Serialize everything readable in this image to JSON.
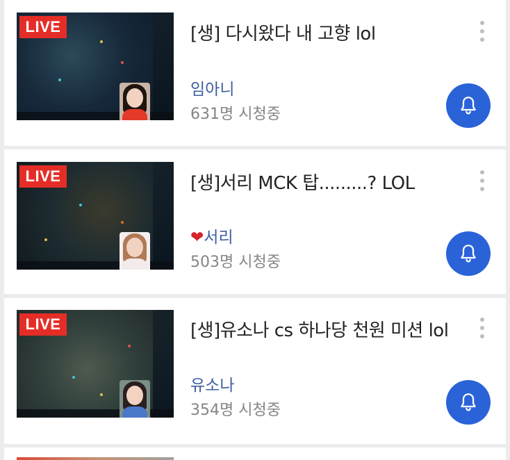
{
  "live_label": "LIVE",
  "streams": [
    {
      "title": "[생] 다시왔다 내 고향 lol",
      "channel_prefix": "",
      "channel": "임아니",
      "viewers": "631명 시청중",
      "thumb_colors": {
        "map": "#16283a",
        "accent": "#264050",
        "hair": "#1e1410",
        "shirt": "#e33a2a"
      }
    },
    {
      "title": "[생]서리 MCK 탑.........? LOL",
      "channel_prefix": "❤",
      "channel": "서리",
      "viewers": "503명 시청중",
      "thumb_colors": {
        "map": "#1d2b30",
        "accent": "#3a3a2c",
        "hair": "#b07a55",
        "shirt": "#f3eaea"
      }
    },
    {
      "title": "[생]유소나 cs 하나당 천원 미션 lol",
      "channel_prefix": "",
      "channel": "유소나",
      "viewers": "354명 시청중",
      "thumb_colors": {
        "map": "#2e3c3a",
        "accent": "#4c5a4e",
        "hair": "#2a1f1f",
        "shirt": "#4a78c8"
      }
    }
  ],
  "icons": {
    "bell": "bell-icon",
    "more": "more-vertical-icon"
  },
  "colors": {
    "live_badge": "#e52d27",
    "channel_link": "#3e5ea0",
    "bell_button": "#2a62d8"
  }
}
